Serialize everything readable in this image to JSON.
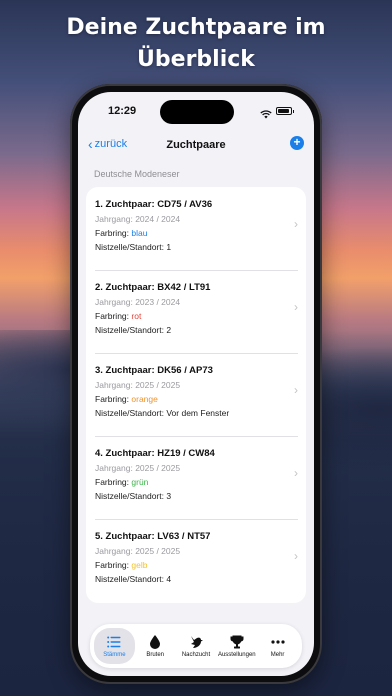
{
  "headline": {
    "line1": "Deine Zuchtpaare im",
    "line2": "Überblick"
  },
  "statusbar": {
    "time": "12:29"
  },
  "navbar": {
    "back_label": "zurück",
    "title": "Zuchtpaare",
    "add_icon": "plus-circle-icon"
  },
  "section_header": "Deutsche Modeneser",
  "labels": {
    "year": "Jahrgang:",
    "ring": "Farbring:",
    "nest": "Nistzelle/Standort:"
  },
  "pairs": [
    {
      "title": "1. Zuchtpaar: CD75 / AV36",
      "year": "2024 / 2024",
      "ring": "blau",
      "ring_color": "#1a7fe8",
      "nest": "1"
    },
    {
      "title": "2. Zuchtpaar: BX42 / LT91",
      "year": "2023 / 2024",
      "ring": "rot",
      "ring_color": "#e0443a",
      "nest": "2"
    },
    {
      "title": "3. Zuchtpaar: DK56 / AP73",
      "year": "2025 / 2025",
      "ring": "orange",
      "ring_color": "#f0932b",
      "nest": "Vor dem Fenster"
    },
    {
      "title": "4. Zuchtpaar: HZ19 / CW84",
      "year": "2025 / 2025",
      "ring": "grün",
      "ring_color": "#3bb54a",
      "nest": "3"
    },
    {
      "title": "5. Zuchtpaar: LV63 / NT57",
      "year": "2025 / 2025",
      "ring": "gelb",
      "ring_color": "#f2c230",
      "nest": "4"
    }
  ],
  "tabbar": [
    {
      "label": "Stämme",
      "icon": "list-icon",
      "active": true
    },
    {
      "label": "Bruten",
      "icon": "drop-icon",
      "active": false
    },
    {
      "label": "Nachzucht",
      "icon": "bird-icon",
      "active": false
    },
    {
      "label": "Ausstellungen",
      "icon": "trophy-icon",
      "active": false
    },
    {
      "label": "Mehr",
      "icon": "more-icon",
      "active": false
    }
  ],
  "colors": {
    "accent": "#1a7fe8",
    "background": "#f2f2f7"
  }
}
